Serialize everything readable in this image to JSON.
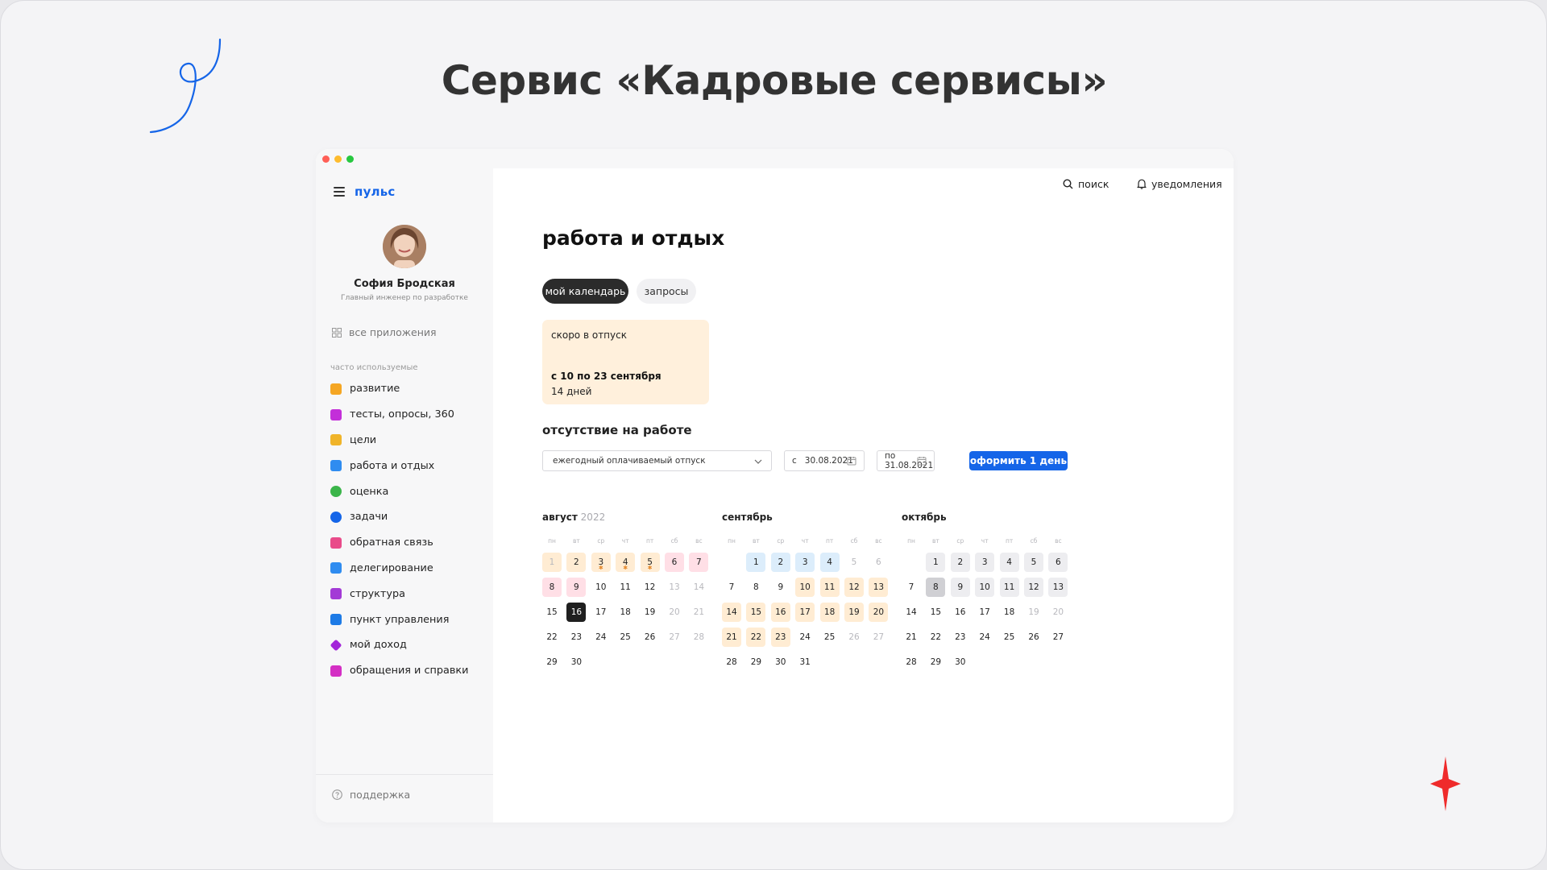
{
  "slide": {
    "title": "Сервис «Кадровые сервисы»"
  },
  "app": {
    "logo": "пульс"
  },
  "user": {
    "name": "София Бродская",
    "role": "Главный инженер по разработке"
  },
  "sidebar": {
    "all_apps": "все приложения",
    "frequent_label": "часто используемые",
    "items": [
      {
        "label": "развитие",
        "icon": "book-icon",
        "color": "#f5a623"
      },
      {
        "label": "тесты, опросы, 360",
        "icon": "checkbox-icon",
        "color": "#c32fd9"
      },
      {
        "label": "цели",
        "icon": "flag-icon",
        "color": "#f0b429"
      },
      {
        "label": "работа и отдых",
        "icon": "chat-icon",
        "color": "#2f8cf0"
      },
      {
        "label": "оценка",
        "icon": "star-badge-icon",
        "color": "#3bb54a"
      },
      {
        "label": "задачи",
        "icon": "target-icon",
        "color": "#1565e8"
      },
      {
        "label": "обратная связь",
        "icon": "feedback-icon",
        "color": "#e94b8a"
      },
      {
        "label": "делегирование",
        "icon": "people-icon",
        "color": "#2f8cf0"
      },
      {
        "label": "структура",
        "icon": "structure-icon",
        "color": "#a33ad6"
      },
      {
        "label": "пункт управления",
        "icon": "wrench-icon",
        "color": "#1e7be6"
      },
      {
        "label": "мой доход",
        "icon": "diamond-icon",
        "color": "#a326d9"
      },
      {
        "label": "обращения и справки",
        "icon": "document-icon",
        "color": "#d42fc4"
      }
    ],
    "support": "поддержка"
  },
  "topbar": {
    "search": "поиск",
    "notifications": "уведомления"
  },
  "page": {
    "title": "работа и отдых",
    "tabs": [
      {
        "label": "мой календарь",
        "active": true
      },
      {
        "label": "запросы",
        "active": false
      }
    ]
  },
  "vacation_card": {
    "label": "скоро в отпуск",
    "dates": "с 10 по 23 сентября",
    "days": "14 дней"
  },
  "absence": {
    "title": "отсутствие на работе",
    "type_value": "ежегодный оплачиваемый отпуск",
    "from_prefix": "с",
    "from_value": "30.08.2021",
    "to_value": "по 31.08.2021",
    "submit_label": "оформить 1 день"
  },
  "calendar": {
    "weekdays": [
      "пн",
      "вт",
      "ср",
      "чт",
      "пт",
      "сб",
      "вс"
    ],
    "months": [
      {
        "name": "август",
        "year": "2022",
        "offset": 0,
        "days": 30,
        "marks": {
          "1": "peach",
          "2": "peach",
          "3": "peach",
          "4": "peach",
          "5": "peach",
          "6": "pink",
          "7": "pink",
          "8": "pink",
          "9": "pink",
          "16": "dark"
        },
        "asterisks": [
          3,
          4,
          5
        ],
        "muted": [
          1,
          13,
          14,
          20,
          21,
          27,
          28
        ]
      },
      {
        "name": "сентябрь",
        "year": "",
        "offset": 1,
        "days": 31,
        "marks": {
          "1": "blue",
          "2": "blue",
          "3": "blue",
          "4": "blue",
          "10": "peach",
          "11": "peach",
          "12": "peach",
          "13": "peach",
          "14": "peach",
          "15": "peach",
          "16": "peach",
          "17": "peach",
          "18": "peach",
          "19": "peach",
          "20": "peach",
          "21": "peach",
          "22": "peach",
          "23": "peach"
        },
        "asterisks": [],
        "muted": [
          5,
          6,
          26,
          27
        ]
      },
      {
        "name": "октябрь",
        "year": "",
        "offset": 1,
        "days": 30,
        "marks": {
          "1": "grey",
          "2": "grey",
          "3": "grey",
          "4": "grey",
          "5": "grey",
          "6": "grey",
          "8": "dgrey",
          "9": "grey",
          "10": "grey",
          "11": "grey",
          "12": "grey",
          "13": "grey"
        },
        "asterisks": [],
        "muted": [
          19,
          20
        ]
      }
    ]
  }
}
